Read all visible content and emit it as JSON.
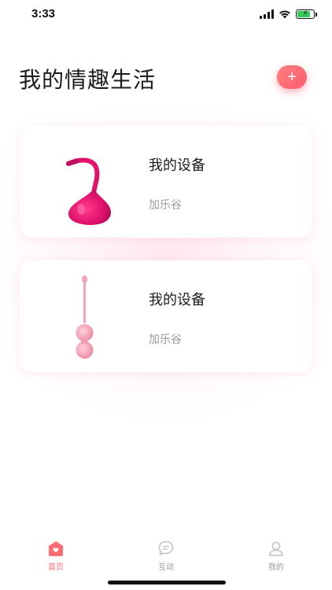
{
  "status_bar": {
    "time": "3:33"
  },
  "header": {
    "title": "我的情趣生活",
    "add_label": "+"
  },
  "devices": [
    {
      "name": "我的设备",
      "brand": "加乐谷",
      "image_icon": "kegel-device-magenta-icon",
      "color": "#e0126c"
    },
    {
      "name": "我的设备",
      "brand": "加乐谷",
      "image_icon": "kegel-balls-pink-icon",
      "color": "#f4a3b7"
    }
  ],
  "tab_bar": {
    "tabs": [
      {
        "label": "首页",
        "icon": "home-icon",
        "active": true
      },
      {
        "label": "互动",
        "icon": "chat-icon",
        "active": false
      },
      {
        "label": "我的",
        "icon": "profile-icon",
        "active": false
      }
    ]
  },
  "colors": {
    "accent": "#ff6b72",
    "accent_gradient_start": "#ff7f7f",
    "accent_gradient_end": "#ff5e6e",
    "text_primary": "#1c1c1c",
    "text_secondary": "#9a9a9a",
    "inactive_tab": "#c4c4c4"
  }
}
